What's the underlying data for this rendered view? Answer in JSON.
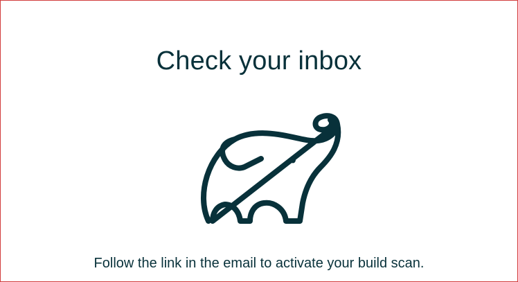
{
  "page": {
    "title": "Check your inbox",
    "message": "Follow the link in the email to activate your build scan."
  },
  "logo": {
    "icon": "gradle-elephant-icon",
    "color": "#08313a"
  },
  "colors": {
    "frame_border": "#d23c3c",
    "text": "#08313a",
    "background": "#ffffff"
  }
}
